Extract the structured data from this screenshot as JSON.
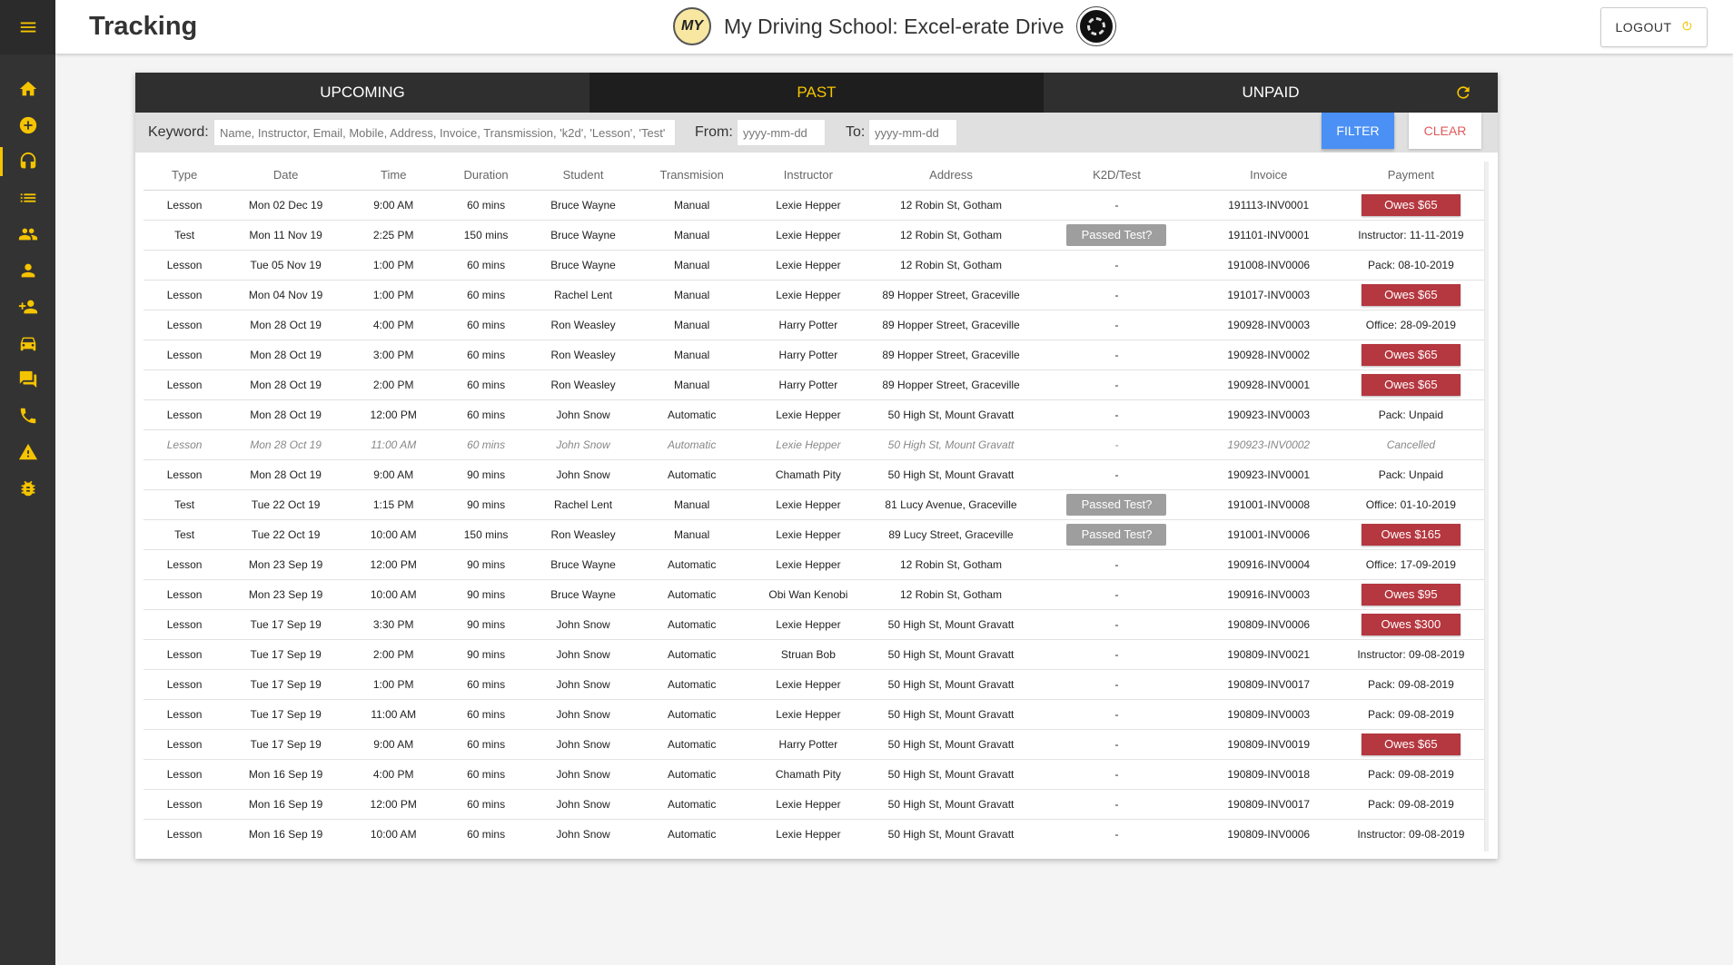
{
  "header": {
    "title": "Tracking",
    "brand_logo_text": "MY",
    "brand_name": "My Driving School: Excel-erate Drive",
    "logout_label": "LOGOUT"
  },
  "sidebar": {
    "items": [
      {
        "name": "home-icon",
        "active": false
      },
      {
        "name": "add-circle-icon",
        "active": false
      },
      {
        "name": "headset-icon",
        "active": true
      },
      {
        "name": "list-icon",
        "active": false
      },
      {
        "name": "group-icon",
        "active": false
      },
      {
        "name": "person-icon",
        "active": false
      },
      {
        "name": "person-add-icon",
        "active": false
      },
      {
        "name": "car-icon",
        "active": false
      },
      {
        "name": "forum-icon",
        "active": false
      },
      {
        "name": "phone-icon",
        "active": false
      },
      {
        "name": "warning-icon",
        "active": false
      },
      {
        "name": "bug-icon",
        "active": false
      }
    ]
  },
  "tabs": {
    "upcoming": "UPCOMING",
    "past": "PAST",
    "unpaid": "UNPAID",
    "active": "past"
  },
  "filters": {
    "keyword_label": "Keyword:",
    "keyword_placeholder": "Name, Instructor, Email, Mobile, Address, Invoice, Transmission, 'k2d', 'Lesson', 'Test'",
    "from_label": "From:",
    "from_placeholder": "yyyy-mm-dd",
    "to_label": "To:",
    "to_placeholder": "yyyy-mm-dd",
    "filter_label": "FILTER",
    "clear_label": "CLEAR"
  },
  "colors": {
    "accent": "#f5c400",
    "owes": "#b5373f",
    "passed": "#9e9e9e",
    "filter_button": "#4a90f5"
  },
  "table": {
    "columns": [
      "Type",
      "Date",
      "Time",
      "Duration",
      "Student",
      "Transmision",
      "Instructor",
      "Address",
      "K2D/Test",
      "Invoice",
      "Payment"
    ],
    "rows": [
      {
        "type": "Lesson",
        "date": "Mon 02 Dec 19",
        "time": "9:00 AM",
        "duration": "60 mins",
        "student": "Bruce Wayne",
        "transmission": "Manual",
        "instructor": "Lexie Hepper",
        "address": "12 Robin St, Gotham",
        "k2d": "-",
        "k2d_badge": false,
        "invoice": "191113-INV0001",
        "payment": "Owes $65",
        "owes": true,
        "cancelled": false
      },
      {
        "type": "Test",
        "date": "Mon 11 Nov 19",
        "time": "2:25 PM",
        "duration": "150 mins",
        "student": "Bruce Wayne",
        "transmission": "Manual",
        "instructor": "Lexie Hepper",
        "address": "12 Robin St, Gotham",
        "k2d": "Passed Test?",
        "k2d_badge": true,
        "invoice": "191101-INV0001",
        "payment": "Instructor: 11-11-2019",
        "owes": false,
        "cancelled": false
      },
      {
        "type": "Lesson",
        "date": "Tue 05 Nov 19",
        "time": "1:00 PM",
        "duration": "60 mins",
        "student": "Bruce Wayne",
        "transmission": "Manual",
        "instructor": "Lexie Hepper",
        "address": "12 Robin St, Gotham",
        "k2d": "-",
        "k2d_badge": false,
        "invoice": "191008-INV0006",
        "payment": "Pack: 08-10-2019",
        "owes": false,
        "cancelled": false
      },
      {
        "type": "Lesson",
        "date": "Mon 04 Nov 19",
        "time": "1:00 PM",
        "duration": "60 mins",
        "student": "Rachel Lent",
        "transmission": "Manual",
        "instructor": "Lexie Hepper",
        "address": "89 Hopper Street, Graceville",
        "k2d": "-",
        "k2d_badge": false,
        "invoice": "191017-INV0003",
        "payment": "Owes $65",
        "owes": true,
        "cancelled": false
      },
      {
        "type": "Lesson",
        "date": "Mon 28 Oct 19",
        "time": "4:00 PM",
        "duration": "60 mins",
        "student": "Ron Weasley",
        "transmission": "Manual",
        "instructor": "Harry Potter",
        "address": "89 Hopper Street, Graceville",
        "k2d": "-",
        "k2d_badge": false,
        "invoice": "190928-INV0003",
        "payment": "Office: 28-09-2019",
        "owes": false,
        "cancelled": false
      },
      {
        "type": "Lesson",
        "date": "Mon 28 Oct 19",
        "time": "3:00 PM",
        "duration": "60 mins",
        "student": "Ron Weasley",
        "transmission": "Manual",
        "instructor": "Harry Potter",
        "address": "89 Hopper Street, Graceville",
        "k2d": "-",
        "k2d_badge": false,
        "invoice": "190928-INV0002",
        "payment": "Owes $65",
        "owes": true,
        "cancelled": false
      },
      {
        "type": "Lesson",
        "date": "Mon 28 Oct 19",
        "time": "2:00 PM",
        "duration": "60 mins",
        "student": "Ron Weasley",
        "transmission": "Manual",
        "instructor": "Harry Potter",
        "address": "89 Hopper Street, Graceville",
        "k2d": "-",
        "k2d_badge": false,
        "invoice": "190928-INV0001",
        "payment": "Owes $65",
        "owes": true,
        "cancelled": false
      },
      {
        "type": "Lesson",
        "date": "Mon 28 Oct 19",
        "time": "12:00 PM",
        "duration": "60 mins",
        "student": "John Snow",
        "transmission": "Automatic",
        "instructor": "Lexie Hepper",
        "address": "50 High St, Mount Gravatt",
        "k2d": "-",
        "k2d_badge": false,
        "invoice": "190923-INV0003",
        "payment": "Pack: Unpaid",
        "owes": false,
        "cancelled": false
      },
      {
        "type": "Lesson",
        "date": "Mon 28 Oct 19",
        "time": "11:00 AM",
        "duration": "60 mins",
        "student": "John Snow",
        "transmission": "Automatic",
        "instructor": "Lexie Hepper",
        "address": "50 High St, Mount Gravatt",
        "k2d": "-",
        "k2d_badge": false,
        "invoice": "190923-INV0002",
        "payment": "Cancelled",
        "owes": false,
        "cancelled": true
      },
      {
        "type": "Lesson",
        "date": "Mon 28 Oct 19",
        "time": "9:00 AM",
        "duration": "90 mins",
        "student": "John Snow",
        "transmission": "Automatic",
        "instructor": "Chamath Pity",
        "address": "50 High St, Mount Gravatt",
        "k2d": "-",
        "k2d_badge": false,
        "invoice": "190923-INV0001",
        "payment": "Pack: Unpaid",
        "owes": false,
        "cancelled": false
      },
      {
        "type": "Test",
        "date": "Tue 22 Oct 19",
        "time": "1:15 PM",
        "duration": "90 mins",
        "student": "Rachel Lent",
        "transmission": "Manual",
        "instructor": "Lexie Hepper",
        "address": "81 Lucy Avenue, Graceville",
        "k2d": "Passed Test?",
        "k2d_badge": true,
        "invoice": "191001-INV0008",
        "payment": "Office: 01-10-2019",
        "owes": false,
        "cancelled": false
      },
      {
        "type": "Test",
        "date": "Tue 22 Oct 19",
        "time": "10:00 AM",
        "duration": "150 mins",
        "student": "Ron Weasley",
        "transmission": "Manual",
        "instructor": "Lexie Hepper",
        "address": "89 Lucy Street, Graceville",
        "k2d": "Passed Test?",
        "k2d_badge": true,
        "invoice": "191001-INV0006",
        "payment": "Owes $165",
        "owes": true,
        "cancelled": false
      },
      {
        "type": "Lesson",
        "date": "Mon 23 Sep 19",
        "time": "12:00 PM",
        "duration": "90 mins",
        "student": "Bruce Wayne",
        "transmission": "Automatic",
        "instructor": "Lexie Hepper",
        "address": "12 Robin St, Gotham",
        "k2d": "-",
        "k2d_badge": false,
        "invoice": "190916-INV0004",
        "payment": "Office: 17-09-2019",
        "owes": false,
        "cancelled": false
      },
      {
        "type": "Lesson",
        "date": "Mon 23 Sep 19",
        "time": "10:00 AM",
        "duration": "90 mins",
        "student": "Bruce Wayne",
        "transmission": "Automatic",
        "instructor": "Obi Wan Kenobi",
        "address": "12 Robin St, Gotham",
        "k2d": "-",
        "k2d_badge": false,
        "invoice": "190916-INV0003",
        "payment": "Owes $95",
        "owes": true,
        "cancelled": false
      },
      {
        "type": "Lesson",
        "date": "Tue 17 Sep 19",
        "time": "3:30 PM",
        "duration": "90 mins",
        "student": "John Snow",
        "transmission": "Automatic",
        "instructor": "Lexie Hepper",
        "address": "50 High St, Mount Gravatt",
        "k2d": "-",
        "k2d_badge": false,
        "invoice": "190809-INV0006",
        "payment": "Owes $300",
        "owes": true,
        "cancelled": false
      },
      {
        "type": "Lesson",
        "date": "Tue 17 Sep 19",
        "time": "2:00 PM",
        "duration": "90 mins",
        "student": "John Snow",
        "transmission": "Automatic",
        "instructor": "Struan Bob",
        "address": "50 High St, Mount Gravatt",
        "k2d": "-",
        "k2d_badge": false,
        "invoice": "190809-INV0021",
        "payment": "Instructor: 09-08-2019",
        "owes": false,
        "cancelled": false
      },
      {
        "type": "Lesson",
        "date": "Tue 17 Sep 19",
        "time": "1:00 PM",
        "duration": "60 mins",
        "student": "John Snow",
        "transmission": "Automatic",
        "instructor": "Lexie Hepper",
        "address": "50 High St, Mount Gravatt",
        "k2d": "-",
        "k2d_badge": false,
        "invoice": "190809-INV0017",
        "payment": "Pack: 09-08-2019",
        "owes": false,
        "cancelled": false
      },
      {
        "type": "Lesson",
        "date": "Tue 17 Sep 19",
        "time": "11:00 AM",
        "duration": "60 mins",
        "student": "John Snow",
        "transmission": "Automatic",
        "instructor": "Lexie Hepper",
        "address": "50 High St, Mount Gravatt",
        "k2d": "-",
        "k2d_badge": false,
        "invoice": "190809-INV0003",
        "payment": "Pack: 09-08-2019",
        "owes": false,
        "cancelled": false
      },
      {
        "type": "Lesson",
        "date": "Tue 17 Sep 19",
        "time": "9:00 AM",
        "duration": "60 mins",
        "student": "John Snow",
        "transmission": "Automatic",
        "instructor": "Harry Potter",
        "address": "50 High St, Mount Gravatt",
        "k2d": "-",
        "k2d_badge": false,
        "invoice": "190809-INV0019",
        "payment": "Owes $65",
        "owes": true,
        "cancelled": false
      },
      {
        "type": "Lesson",
        "date": "Mon 16 Sep 19",
        "time": "4:00 PM",
        "duration": "60 mins",
        "student": "John Snow",
        "transmission": "Automatic",
        "instructor": "Chamath Pity",
        "address": "50 High St, Mount Gravatt",
        "k2d": "-",
        "k2d_badge": false,
        "invoice": "190809-INV0018",
        "payment": "Pack: 09-08-2019",
        "owes": false,
        "cancelled": false
      },
      {
        "type": "Lesson",
        "date": "Mon 16 Sep 19",
        "time": "12:00 PM",
        "duration": "60 mins",
        "student": "John Snow",
        "transmission": "Automatic",
        "instructor": "Lexie Hepper",
        "address": "50 High St, Mount Gravatt",
        "k2d": "-",
        "k2d_badge": false,
        "invoice": "190809-INV0017",
        "payment": "Pack: 09-08-2019",
        "owes": false,
        "cancelled": false
      },
      {
        "type": "Lesson",
        "date": "Mon 16 Sep 19",
        "time": "10:00 AM",
        "duration": "60 mins",
        "student": "John Snow",
        "transmission": "Automatic",
        "instructor": "Lexie Hepper",
        "address": "50 High St, Mount Gravatt",
        "k2d": "-",
        "k2d_badge": false,
        "invoice": "190809-INV0006",
        "payment": "Instructor: 09-08-2019",
        "owes": false,
        "cancelled": false
      }
    ]
  }
}
